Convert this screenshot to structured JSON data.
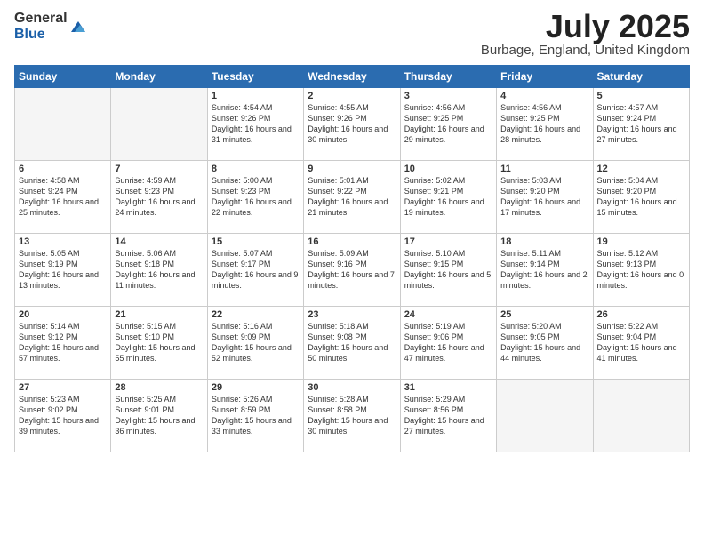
{
  "logo": {
    "general": "General",
    "blue": "Blue"
  },
  "title": {
    "month_year": "July 2025",
    "location": "Burbage, England, United Kingdom"
  },
  "headers": [
    "Sunday",
    "Monday",
    "Tuesday",
    "Wednesday",
    "Thursday",
    "Friday",
    "Saturday"
  ],
  "weeks": [
    [
      {
        "day": "",
        "empty": true
      },
      {
        "day": "",
        "empty": true
      },
      {
        "day": "1",
        "sunrise": "Sunrise: 4:54 AM",
        "sunset": "Sunset: 9:26 PM",
        "daylight": "Daylight: 16 hours and 31 minutes."
      },
      {
        "day": "2",
        "sunrise": "Sunrise: 4:55 AM",
        "sunset": "Sunset: 9:26 PM",
        "daylight": "Daylight: 16 hours and 30 minutes."
      },
      {
        "day": "3",
        "sunrise": "Sunrise: 4:56 AM",
        "sunset": "Sunset: 9:25 PM",
        "daylight": "Daylight: 16 hours and 29 minutes."
      },
      {
        "day": "4",
        "sunrise": "Sunrise: 4:56 AM",
        "sunset": "Sunset: 9:25 PM",
        "daylight": "Daylight: 16 hours and 28 minutes."
      },
      {
        "day": "5",
        "sunrise": "Sunrise: 4:57 AM",
        "sunset": "Sunset: 9:24 PM",
        "daylight": "Daylight: 16 hours and 27 minutes."
      }
    ],
    [
      {
        "day": "6",
        "sunrise": "Sunrise: 4:58 AM",
        "sunset": "Sunset: 9:24 PM",
        "daylight": "Daylight: 16 hours and 25 minutes."
      },
      {
        "day": "7",
        "sunrise": "Sunrise: 4:59 AM",
        "sunset": "Sunset: 9:23 PM",
        "daylight": "Daylight: 16 hours and 24 minutes."
      },
      {
        "day": "8",
        "sunrise": "Sunrise: 5:00 AM",
        "sunset": "Sunset: 9:23 PM",
        "daylight": "Daylight: 16 hours and 22 minutes."
      },
      {
        "day": "9",
        "sunrise": "Sunrise: 5:01 AM",
        "sunset": "Sunset: 9:22 PM",
        "daylight": "Daylight: 16 hours and 21 minutes."
      },
      {
        "day": "10",
        "sunrise": "Sunrise: 5:02 AM",
        "sunset": "Sunset: 9:21 PM",
        "daylight": "Daylight: 16 hours and 19 minutes."
      },
      {
        "day": "11",
        "sunrise": "Sunrise: 5:03 AM",
        "sunset": "Sunset: 9:20 PM",
        "daylight": "Daylight: 16 hours and 17 minutes."
      },
      {
        "day": "12",
        "sunrise": "Sunrise: 5:04 AM",
        "sunset": "Sunset: 9:20 PM",
        "daylight": "Daylight: 16 hours and 15 minutes."
      }
    ],
    [
      {
        "day": "13",
        "sunrise": "Sunrise: 5:05 AM",
        "sunset": "Sunset: 9:19 PM",
        "daylight": "Daylight: 16 hours and 13 minutes."
      },
      {
        "day": "14",
        "sunrise": "Sunrise: 5:06 AM",
        "sunset": "Sunset: 9:18 PM",
        "daylight": "Daylight: 16 hours and 11 minutes."
      },
      {
        "day": "15",
        "sunrise": "Sunrise: 5:07 AM",
        "sunset": "Sunset: 9:17 PM",
        "daylight": "Daylight: 16 hours and 9 minutes."
      },
      {
        "day": "16",
        "sunrise": "Sunrise: 5:09 AM",
        "sunset": "Sunset: 9:16 PM",
        "daylight": "Daylight: 16 hours and 7 minutes."
      },
      {
        "day": "17",
        "sunrise": "Sunrise: 5:10 AM",
        "sunset": "Sunset: 9:15 PM",
        "daylight": "Daylight: 16 hours and 5 minutes."
      },
      {
        "day": "18",
        "sunrise": "Sunrise: 5:11 AM",
        "sunset": "Sunset: 9:14 PM",
        "daylight": "Daylight: 16 hours and 2 minutes."
      },
      {
        "day": "19",
        "sunrise": "Sunrise: 5:12 AM",
        "sunset": "Sunset: 9:13 PM",
        "daylight": "Daylight: 16 hours and 0 minutes."
      }
    ],
    [
      {
        "day": "20",
        "sunrise": "Sunrise: 5:14 AM",
        "sunset": "Sunset: 9:12 PM",
        "daylight": "Daylight: 15 hours and 57 minutes."
      },
      {
        "day": "21",
        "sunrise": "Sunrise: 5:15 AM",
        "sunset": "Sunset: 9:10 PM",
        "daylight": "Daylight: 15 hours and 55 minutes."
      },
      {
        "day": "22",
        "sunrise": "Sunrise: 5:16 AM",
        "sunset": "Sunset: 9:09 PM",
        "daylight": "Daylight: 15 hours and 52 minutes."
      },
      {
        "day": "23",
        "sunrise": "Sunrise: 5:18 AM",
        "sunset": "Sunset: 9:08 PM",
        "daylight": "Daylight: 15 hours and 50 minutes."
      },
      {
        "day": "24",
        "sunrise": "Sunrise: 5:19 AM",
        "sunset": "Sunset: 9:06 PM",
        "daylight": "Daylight: 15 hours and 47 minutes."
      },
      {
        "day": "25",
        "sunrise": "Sunrise: 5:20 AM",
        "sunset": "Sunset: 9:05 PM",
        "daylight": "Daylight: 15 hours and 44 minutes."
      },
      {
        "day": "26",
        "sunrise": "Sunrise: 5:22 AM",
        "sunset": "Sunset: 9:04 PM",
        "daylight": "Daylight: 15 hours and 41 minutes."
      }
    ],
    [
      {
        "day": "27",
        "sunrise": "Sunrise: 5:23 AM",
        "sunset": "Sunset: 9:02 PM",
        "daylight": "Daylight: 15 hours and 39 minutes."
      },
      {
        "day": "28",
        "sunrise": "Sunrise: 5:25 AM",
        "sunset": "Sunset: 9:01 PM",
        "daylight": "Daylight: 15 hours and 36 minutes."
      },
      {
        "day": "29",
        "sunrise": "Sunrise: 5:26 AM",
        "sunset": "Sunset: 8:59 PM",
        "daylight": "Daylight: 15 hours and 33 minutes."
      },
      {
        "day": "30",
        "sunrise": "Sunrise: 5:28 AM",
        "sunset": "Sunset: 8:58 PM",
        "daylight": "Daylight: 15 hours and 30 minutes."
      },
      {
        "day": "31",
        "sunrise": "Sunrise: 5:29 AM",
        "sunset": "Sunset: 8:56 PM",
        "daylight": "Daylight: 15 hours and 27 minutes."
      },
      {
        "day": "",
        "empty": true
      },
      {
        "day": "",
        "empty": true
      }
    ]
  ]
}
